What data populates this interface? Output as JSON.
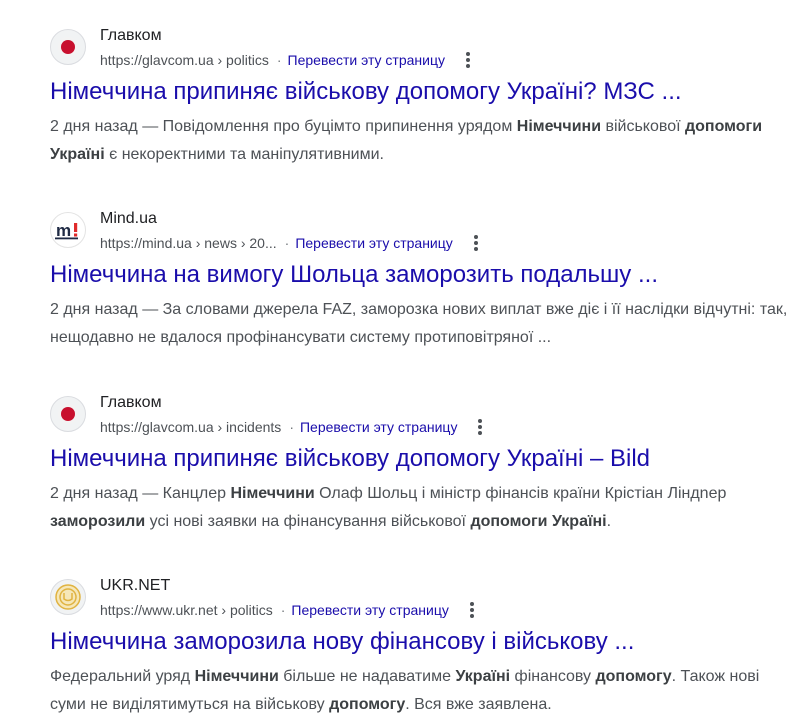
{
  "results": [
    {
      "site_name": "Главком",
      "url": "https://glavcom.ua › politics",
      "translate": "Перевести эту страницу",
      "title": "Німеччина припиняє військову допомогу Україні? МЗС ...",
      "favicon": "glavcom-red-dot-icon",
      "snippet": [
        {
          "t": "2 дня назад — Повідомлення про буцімто припинення урядом ",
          "b": false
        },
        {
          "t": "Німеччини",
          "b": true
        },
        {
          "t": " військової ",
          "b": false
        },
        {
          "t": "допомоги Україні",
          "b": true
        },
        {
          "t": " є некоректними та маніпулятивними.",
          "b": false
        }
      ]
    },
    {
      "site_name": "Mind.ua",
      "url": "https://mind.ua › news › 20...",
      "translate": "Перевести эту страницу",
      "title": "Німеччина на вимогу Шольца заморозить подальшу ...",
      "favicon": "mind-logo-icon",
      "snippet": [
        {
          "t": "2 дня назад — За словами джерела FAZ, заморозка нових виплат вже діє і її наслідки відчутні: так, нещодавно не вдалося профінансувати систему протиповітряної ...",
          "b": false
        }
      ]
    },
    {
      "site_name": "Главком",
      "url": "https://glavcom.ua › incidents",
      "translate": "Перевести эту страницу",
      "title": "Німеччина припиняє військову допомогу Україні – Bild",
      "favicon": "glavcom-red-dot-icon",
      "snippet": [
        {
          "t": "2 дня назад — Канцлер ",
          "b": false
        },
        {
          "t": "Німеччини",
          "b": true
        },
        {
          "t": " Олаф Шольц і міністр фінансів країни Крістіан Ліндner",
          "b": false
        }
      ]
    },
    {
      "site_name": "UKR.NET",
      "url": "https://www.ukr.net › politics",
      "translate": "Перевести эту страницу",
      "title": "Німеччина заморозила нову фінансову і військову ...",
      "favicon": "ukrnet-logo-icon",
      "snippet": [
        {
          "t": "Федеральний уряд ",
          "b": false
        },
        {
          "t": "Німеччини",
          "b": true
        },
        {
          "t": " більше не надаватиме ",
          "b": false
        },
        {
          "t": "Україні",
          "b": true
        },
        {
          "t": " фінансову ",
          "b": false
        },
        {
          "t": "допомогу",
          "b": true
        },
        {
          "t": ". Також нові суми не виділятимуться на військову ",
          "b": false
        },
        {
          "t": "допомогу",
          "b": true
        },
        {
          "t": ". Вся вже заявлена.",
          "b": false
        }
      ]
    }
  ],
  "snippet3_full": [
    {
      "t": "2 дня назад — Канцлер ",
      "b": false
    },
    {
      "t": "Німеччини",
      "b": true
    },
    {
      "t": " Олаф Шольц і міністр фінансів країни Крістіан Ліндnер ",
      "b": false
    },
    {
      "t": "заморозили",
      "b": true
    },
    {
      "t": " усі нові заявки на фінансування військової ",
      "b": false
    },
    {
      "t": "допомоги Україні",
      "b": true
    },
    {
      "t": ".",
      "b": false
    }
  ],
  "colors": {
    "link": "#1a0dab",
    "text": "#4d5156",
    "glavcom_red": "#c8102e",
    "ukrnet_gold": "#e0b341"
  }
}
